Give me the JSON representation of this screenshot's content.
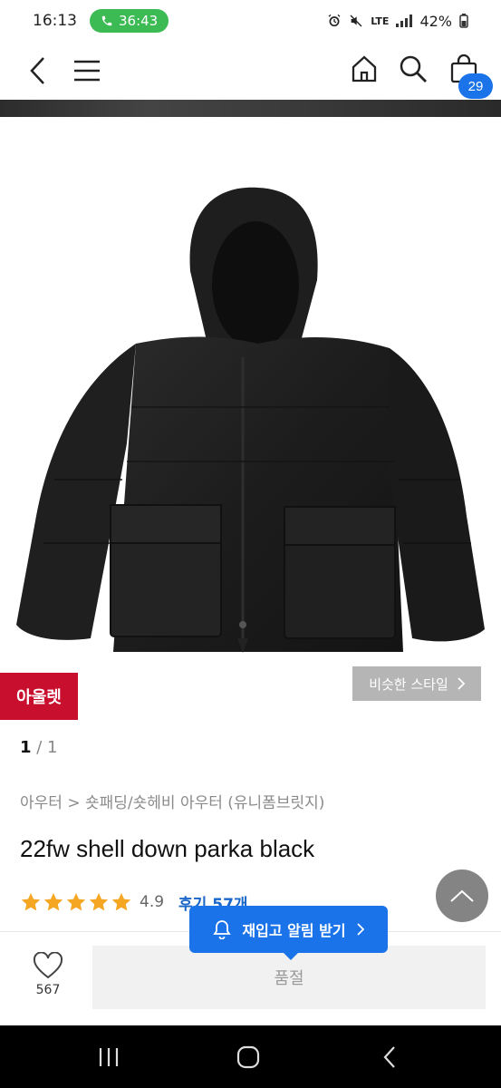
{
  "status_bar": {
    "time": "16:13",
    "call_duration": "36:43",
    "network": "LTE",
    "battery": "42%"
  },
  "header": {
    "back_icon": "chevron-left-icon",
    "menu_icon": "hamburger-menu-icon",
    "home_icon": "home-icon",
    "search_icon": "search-icon",
    "cart_icon": "shopping-bag-icon",
    "cart_count": "29"
  },
  "product": {
    "outlet_badge": "아울렛",
    "similar_style_label": "비슷한 스타일",
    "page_current": "1",
    "page_separator": " / ",
    "page_total": "1",
    "breadcrumb": "아우터 > 숏패딩/숏헤비 아우터 (유니폼브릿지)",
    "title": "22fw shell down parka black",
    "rating": "4.9",
    "stars_filled": 5,
    "review_link": "후기 57개"
  },
  "restock_popup": {
    "label": "재입고 알림 받기"
  },
  "bottom_bar": {
    "like_count": "567",
    "soldout_label": "품절"
  },
  "colors": {
    "accent_blue": "#1a73e8",
    "outlet_red": "#c8102e",
    "star_orange": "#f5a623",
    "call_green": "#3cba54"
  }
}
